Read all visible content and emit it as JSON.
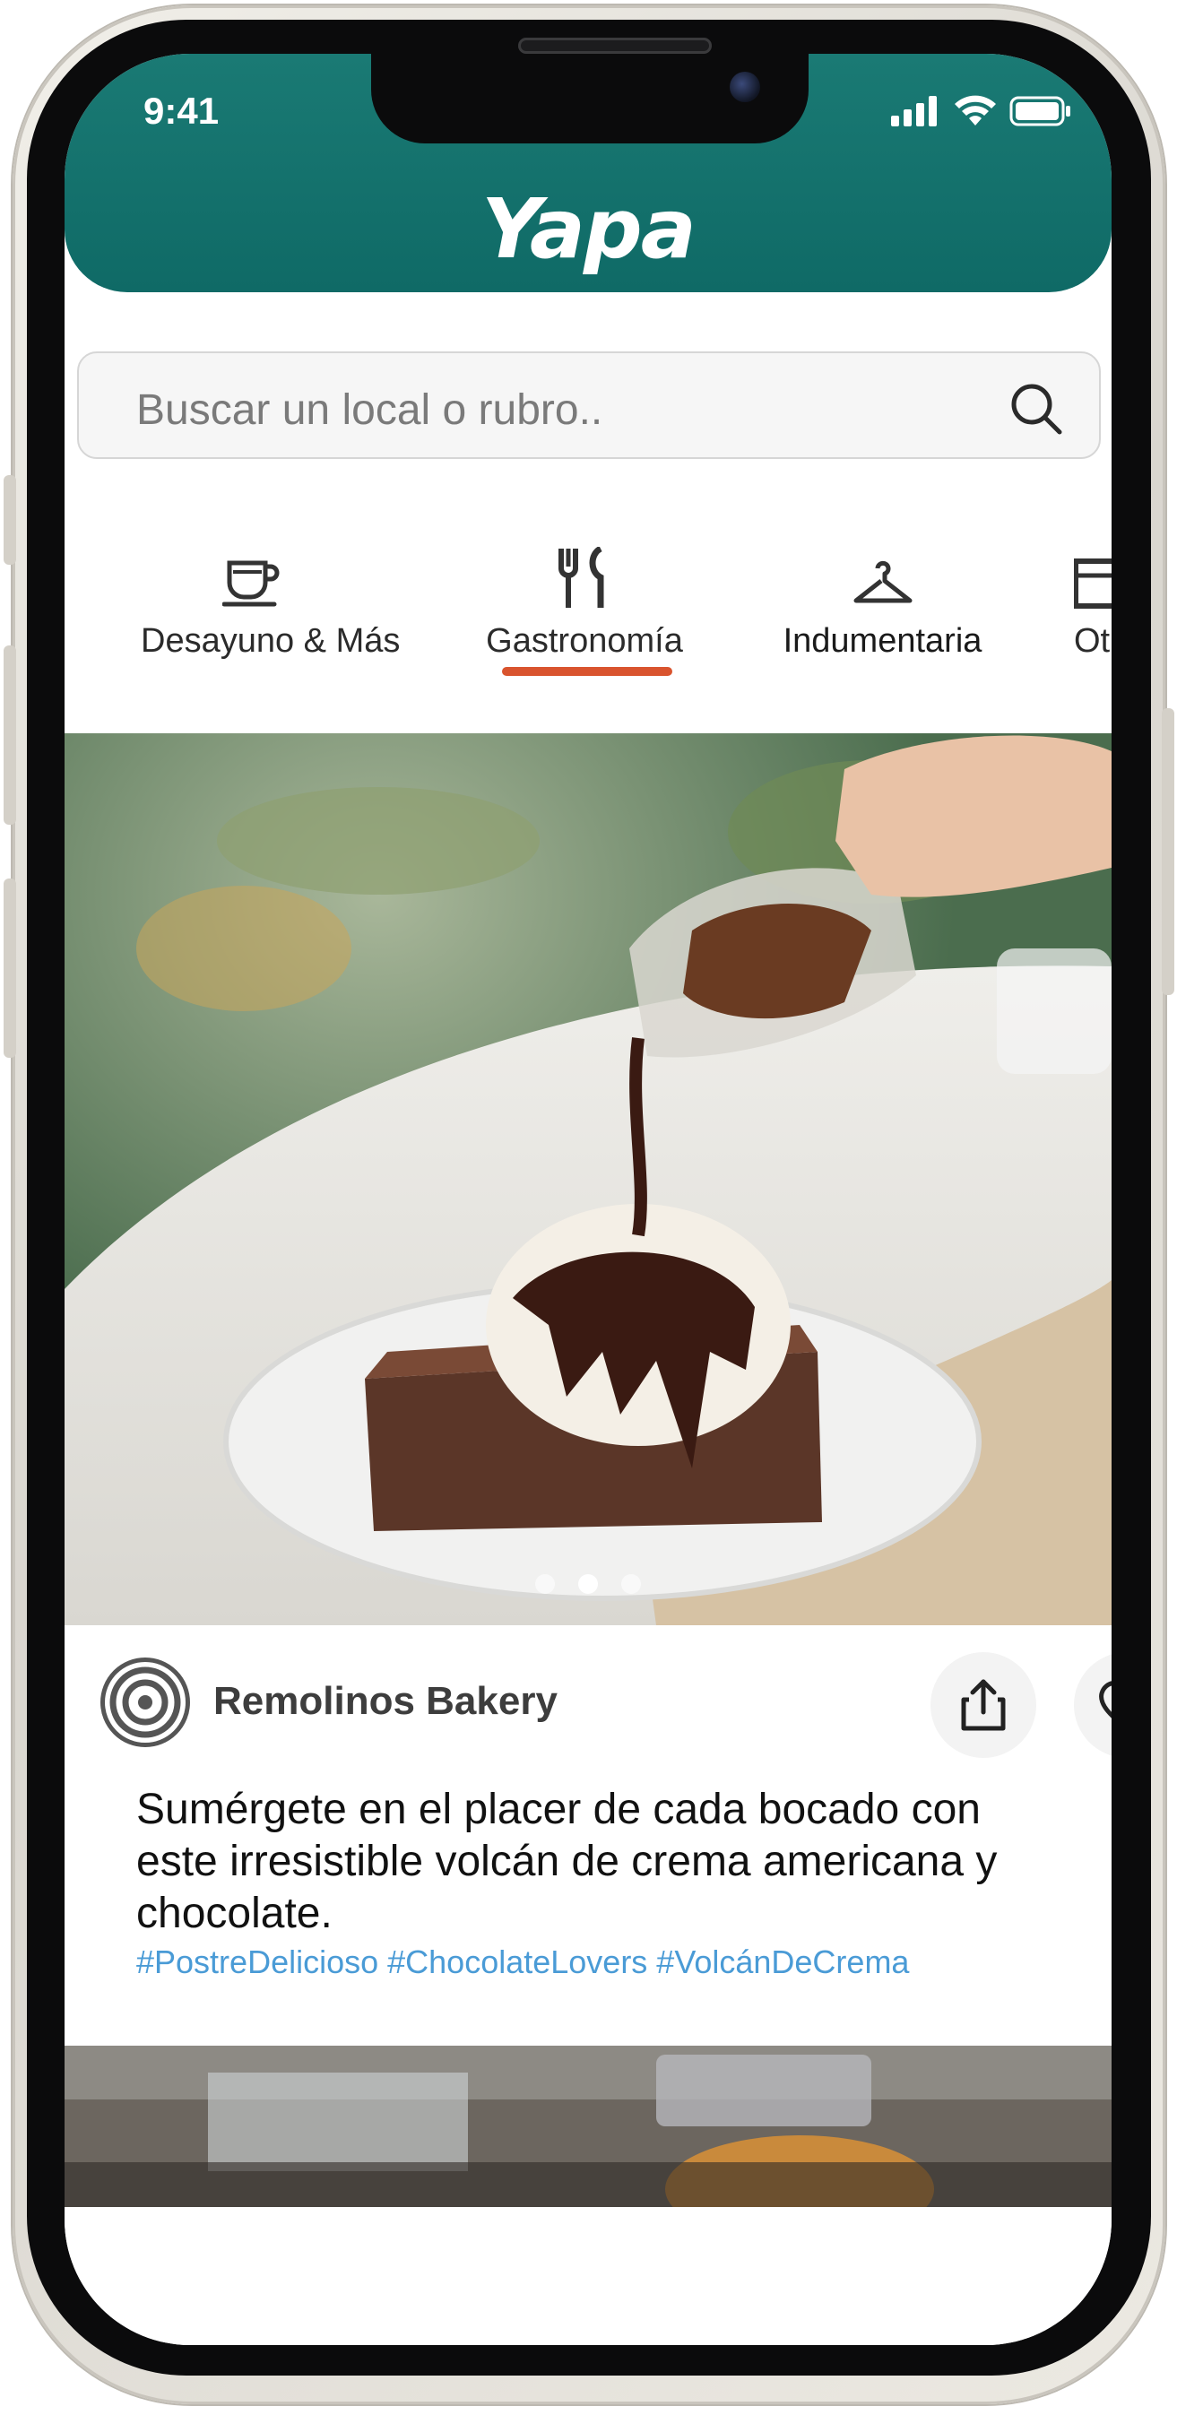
{
  "status_bar": {
    "time": "9:41"
  },
  "header": {
    "logo": "Yapa"
  },
  "search": {
    "placeholder": "Buscar un local o rubro.."
  },
  "categories": [
    {
      "label": "Desayuno & Más",
      "icon": "coffee-cup-icon",
      "selected": false
    },
    {
      "label": "Gastronomía",
      "icon": "fork-knife-icon",
      "selected": true
    },
    {
      "label": "Indumentaria",
      "icon": "hanger-icon",
      "selected": false
    },
    {
      "label": "Ot",
      "icon": "shop-icon",
      "selected": false
    }
  ],
  "post": {
    "store_name": "Remolinos Bakery",
    "caption": "Sumérgete en el placer de cada bocado con este irresistible volcán de crema americana y chocolate.",
    "hashtags": "#PostreDelicioso #ChocolateLovers #VolcánDeCrema",
    "carousel": {
      "count": 3,
      "active": 1
    }
  },
  "colors": {
    "header": "#0f6a66",
    "accent_underline": "#d9542e",
    "hashtag": "#4a9bd6"
  }
}
